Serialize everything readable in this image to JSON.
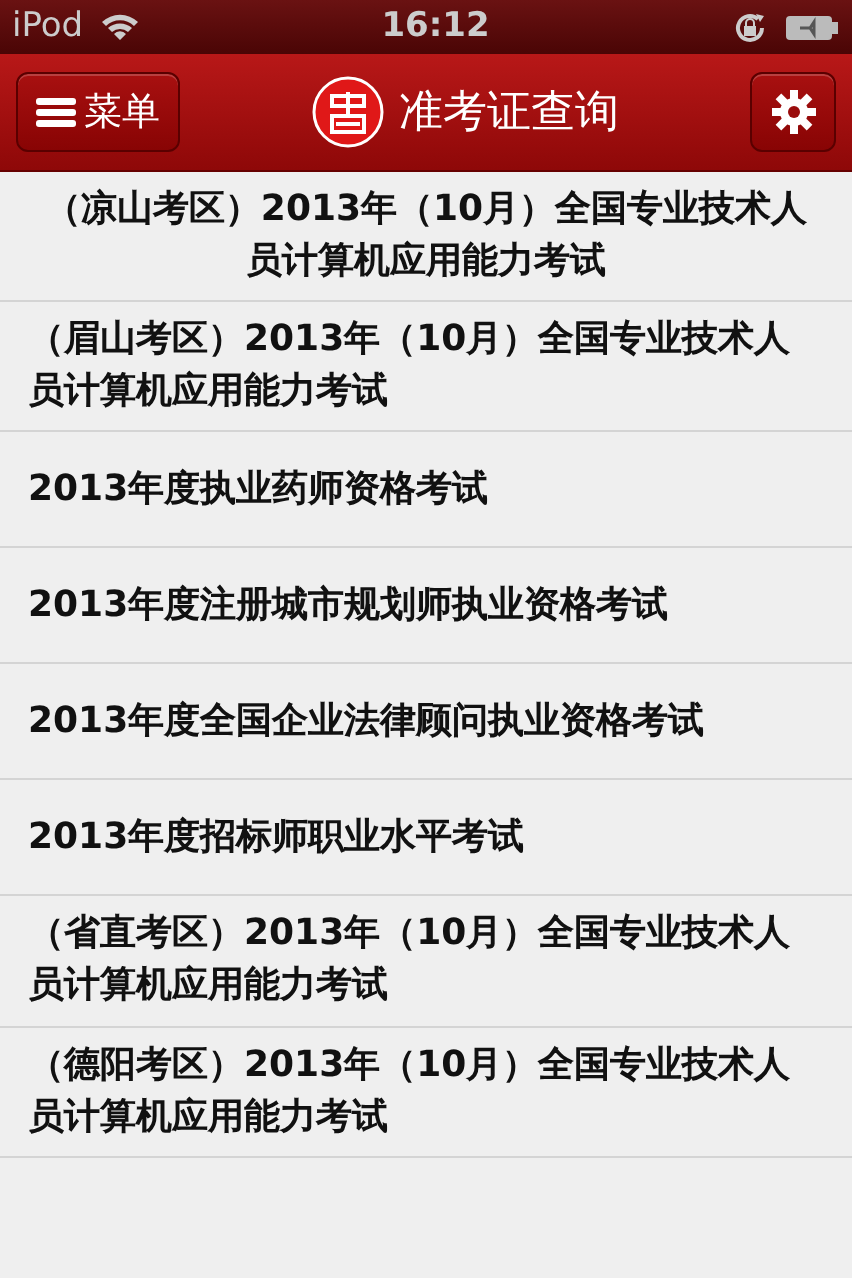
{
  "status_bar": {
    "carrier": "iPod",
    "time": "16:12"
  },
  "nav_bar": {
    "menu_button": "菜单",
    "title": "准考证查询"
  },
  "exams": [
    {
      "title": "（凉山考区）2013年（10月）全国专业技术人员计算机应用能力考试",
      "kind": "centered"
    },
    {
      "title": "（眉山考区）2013年（10月）全国专业技术人员计算机应用能力考试",
      "kind": "left"
    },
    {
      "title": "2013年度执业药师资格考试",
      "kind": "left"
    },
    {
      "title": "2013年度注册城市规划师执业资格考试",
      "kind": "left"
    },
    {
      "title": "2013年度全国企业法律顾问执业资格考试",
      "kind": "left"
    },
    {
      "title": "2013年度招标师职业水平考试",
      "kind": "left"
    },
    {
      "title": "（省直考区）2013年（10月）全国专业技术人员计算机应用能力考试",
      "kind": "left"
    },
    {
      "title": "（德阳考区）2013年（10月）全国专业技术人员计算机应用能力考试",
      "kind": "left"
    }
  ]
}
